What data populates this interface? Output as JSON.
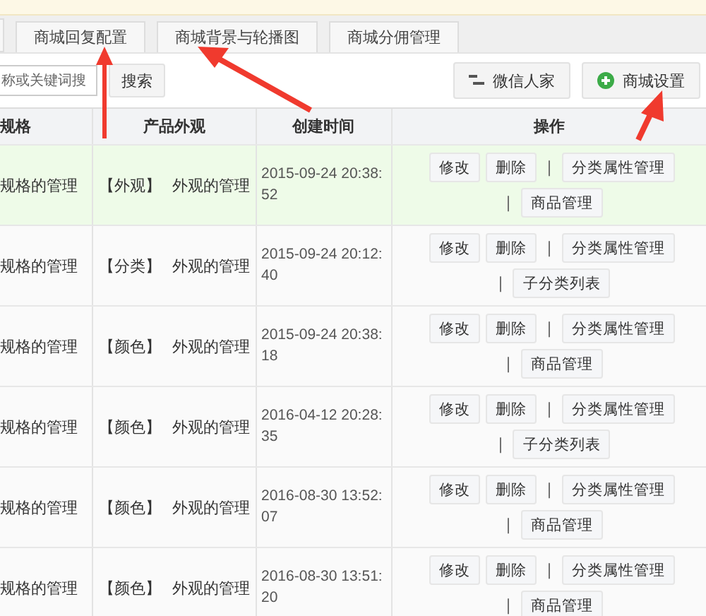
{
  "tabs": [
    {
      "label": "商城回复配置"
    },
    {
      "label": "商城背景与轮播图"
    },
    {
      "label": "商城分佣管理"
    }
  ],
  "toolbar": {
    "search": {
      "placeholder": "称或关键词搜"
    },
    "search_button": "搜索",
    "buttons": [
      {
        "label": "微信人家",
        "kind": "lines"
      },
      {
        "label": "商城设置",
        "kind": "add"
      }
    ]
  },
  "table": {
    "columns": [
      "规格",
      "产品外观",
      "创建时间",
      "操作"
    ],
    "rows": [
      {
        "selected": true,
        "spec": "规格的管理",
        "tag": "【外观】",
        "look": "外观的管理",
        "time": "2015-09-24 20:38:52",
        "actions": [
          {
            "kind": "button",
            "label": "修改"
          },
          {
            "kind": "button",
            "label": "删除"
          },
          {
            "kind": "separator",
            "label": "|"
          },
          {
            "kind": "button",
            "label": "分类属性管理"
          },
          {
            "kind": "separator",
            "label": "|"
          },
          {
            "kind": "button",
            "label": "商品管理"
          }
        ]
      },
      {
        "selected": false,
        "spec": "规格的管理",
        "tag": "【分类】",
        "look": "外观的管理",
        "time": "2015-09-24 20:12:40",
        "actions": [
          {
            "kind": "button",
            "label": "修改"
          },
          {
            "kind": "button",
            "label": "删除"
          },
          {
            "kind": "separator",
            "label": "|"
          },
          {
            "kind": "button",
            "label": "分类属性管理"
          },
          {
            "kind": "separator",
            "label": "|"
          },
          {
            "kind": "button",
            "label": "子分类列表"
          }
        ]
      },
      {
        "selected": false,
        "spec": "规格的管理",
        "tag": "【颜色】",
        "look": "外观的管理",
        "time": "2015-09-24 20:38:18",
        "actions": [
          {
            "kind": "button",
            "label": "修改"
          },
          {
            "kind": "button",
            "label": "删除"
          },
          {
            "kind": "separator",
            "label": "|"
          },
          {
            "kind": "button",
            "label": "分类属性管理"
          },
          {
            "kind": "separator",
            "label": "|"
          },
          {
            "kind": "button",
            "label": "商品管理"
          }
        ]
      },
      {
        "selected": false,
        "spec": "规格的管理",
        "tag": "【颜色】",
        "look": "外观的管理",
        "time": "2016-04-12 20:28:35",
        "actions": [
          {
            "kind": "button",
            "label": "修改"
          },
          {
            "kind": "button",
            "label": "删除"
          },
          {
            "kind": "separator",
            "label": "|"
          },
          {
            "kind": "button",
            "label": "分类属性管理"
          },
          {
            "kind": "separator",
            "label": "|"
          },
          {
            "kind": "button",
            "label": "子分类列表"
          }
        ]
      },
      {
        "selected": false,
        "spec": "规格的管理",
        "tag": "【颜色】",
        "look": "外观的管理",
        "time": "2016-08-30 13:52:07",
        "actions": [
          {
            "kind": "button",
            "label": "修改"
          },
          {
            "kind": "button",
            "label": "删除"
          },
          {
            "kind": "separator",
            "label": "|"
          },
          {
            "kind": "button",
            "label": "分类属性管理"
          },
          {
            "kind": "separator",
            "label": "|"
          },
          {
            "kind": "button",
            "label": "商品管理"
          }
        ]
      },
      {
        "selected": false,
        "spec": "规格的管理",
        "tag": "【颜色】",
        "look": "外观的管理",
        "time": "2016-08-30 13:51:20",
        "actions": [
          {
            "kind": "button",
            "label": "修改"
          },
          {
            "kind": "button",
            "label": "删除"
          },
          {
            "kind": "separator",
            "label": "|"
          },
          {
            "kind": "button",
            "label": "分类属性管理"
          },
          {
            "kind": "separator",
            "label": "|"
          },
          {
            "kind": "button",
            "label": "商品管理"
          }
        ]
      }
    ]
  }
}
